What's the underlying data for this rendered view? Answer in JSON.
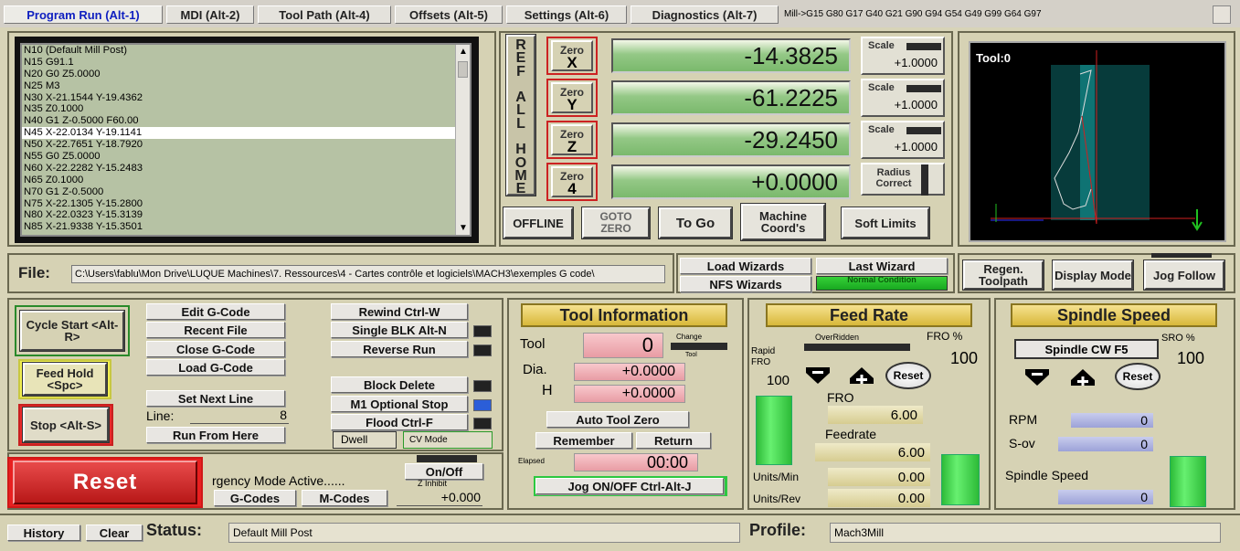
{
  "tabs": [
    "Program Run (Alt-1)",
    "MDI (Alt-2)",
    "Tool Path (Alt-4)",
    "Offsets (Alt-5)",
    "Settings (Alt-6)",
    "Diagnostics (Alt-7)"
  ],
  "modal_line": "Mill->G15  G80 G17 G40 G21 G90 G94 G54 G49 G99 G64 G97",
  "gcode_lines": [
    "N10 (Default Mill Post)",
    "N15  G91.1",
    "N20 G0  Z5.0000",
    "N25 M3",
    "N30  X-21.1544  Y-19.4362",
    "N35  Z0.1000",
    "N40 G1  Z-0.5000  F60.00",
    "N45  X-22.0134  Y-19.1141",
    "N50  X-22.7651  Y-18.7920",
    "N55 G0  Z5.0000",
    "N60  X-22.2282  Y-15.2483",
    "N65  Z0.1000",
    "N70 G1  Z-0.5000",
    "N75  X-22.1305  Y-15.2800",
    "N80  X-22.0323  Y-15.3139",
    "N85  X-21.9338  Y-15.3501"
  ],
  "selected_line_index": 7,
  "ref_all_home": [
    "R",
    "E",
    "F",
    " ",
    "A",
    "L",
    "L",
    " ",
    "H",
    "O",
    "M",
    "E"
  ],
  "axes": [
    {
      "zero": "Zero",
      "letter": "X",
      "value": "-14.3825",
      "scale_label": "Scale",
      "scale": "+1.0000"
    },
    {
      "zero": "Zero",
      "letter": "Y",
      "value": "-61.2225",
      "scale_label": "Scale",
      "scale": "+1.0000"
    },
    {
      "zero": "Zero",
      "letter": "Z",
      "value": "-29.2450",
      "scale_label": "Scale",
      "scale": "+1.0000"
    },
    {
      "zero": "Zero",
      "letter": "4",
      "value": "+0.0000"
    }
  ],
  "radius_correct": "Radius Correct",
  "dro_buttons": {
    "offline": "OFFLINE",
    "goto_zero": "GOTO ZERO",
    "to_go": "To Go",
    "machine_coords": "Machine Coord's",
    "soft_limits": "Soft Limits"
  },
  "toolpath": {
    "label": "Tool:0"
  },
  "file": {
    "label": "File:",
    "path": "C:\\Users\\fablu\\Mon Drive\\LUQUE Machines\\7. Ressources\\4 - Cartes contrôle et logiciels\\MACH3\\exemples G code\\"
  },
  "wizards": {
    "load": "Load Wizards",
    "last": "Last Wizard",
    "nfs": "NFS Wizards",
    "condition": "Normal Condition"
  },
  "view_buttons": {
    "regen": "Regen. Toolpath",
    "display": "Display Mode",
    "jog_follow": "Jog Follow"
  },
  "cycle": {
    "start": "Cycle Start <Alt-R>",
    "hold": "Feed Hold <Spc>",
    "stop": "Stop <Alt-S>"
  },
  "program_buttons": {
    "edit": "Edit G-Code",
    "recent": "Recent File",
    "close": "Close G-Code",
    "load": "Load G-Code",
    "set_next": "Set Next Line",
    "line_label": "Line:",
    "line_value": "8",
    "run_from_here": "Run From Here"
  },
  "program_buttons_right": {
    "rewind": "Rewind Ctrl-W",
    "single": "Single BLK Alt-N",
    "reverse": "Reverse Run",
    "block_delete": "Block Delete",
    "m1": "M1 Optional Stop",
    "flood": "Flood Ctrl-F",
    "dwell": "Dwell",
    "cv_mode": "CV Mode"
  },
  "reset": {
    "label": "Reset",
    "emergency": "rgency Mode Active......",
    "gcodes": "G-Codes",
    "mcodes": "M-Codes",
    "onoff": "On/Off",
    "z_inhibit": "Z Inhibit",
    "z_value": "+0.000"
  },
  "tool": {
    "heading": "Tool Information",
    "tool_label": "Tool",
    "tool_value": "0",
    "change": "Change",
    "tool_small": "Tool",
    "dia_label": "Dia.",
    "dia_value": "+0.0000",
    "h_label": "H",
    "h_value": "+0.0000",
    "auto_zero": "Auto Tool Zero",
    "remember": "Remember",
    "return": "Return",
    "elapsed_label": "Elapsed",
    "elapsed": "00:00",
    "jog": "Jog ON/OFF Ctrl-Alt-J"
  },
  "feed": {
    "heading": "Feed Rate",
    "overridden": "OverRidden",
    "fro_pct_label": "FRO %",
    "fro_pct": "100",
    "rapid_label": "Rapid FRO",
    "rapid_value": "100",
    "reset": "Reset",
    "fro_label": "FRO",
    "fro_value": "6.00",
    "feedrate_label": "Feedrate",
    "feedrate_value": "6.00",
    "upm_label": "Units/Min",
    "upm_value": "0.00",
    "upr_label": "Units/Rev",
    "upr_value": "0.00"
  },
  "spindle": {
    "heading": "Spindle Speed",
    "cw": "Spindle CW F5",
    "sro_label": "SRO %",
    "sro_value": "100",
    "reset": "Reset",
    "rpm_label": "RPM",
    "rpm_value": "0",
    "sov_label": "S-ov",
    "sov_value": "0",
    "speed_label": "Spindle Speed",
    "speed_value": "0"
  },
  "status": {
    "history": "History",
    "clear": "Clear",
    "label": "Status:",
    "text": "Default Mill Post",
    "profile_label": "Profile:",
    "profile": "Mach3Mill"
  }
}
